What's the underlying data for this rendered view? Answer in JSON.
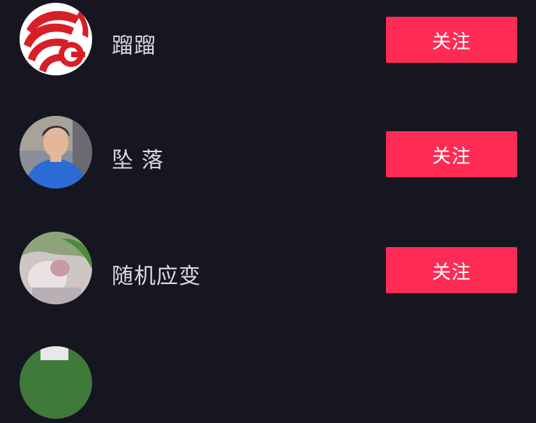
{
  "users": [
    {
      "name": "蹓蹓",
      "follow_label": "关注"
    },
    {
      "name": "坠 落",
      "follow_label": "关注"
    },
    {
      "name": "随机应变",
      "follow_label": "关注"
    }
  ]
}
